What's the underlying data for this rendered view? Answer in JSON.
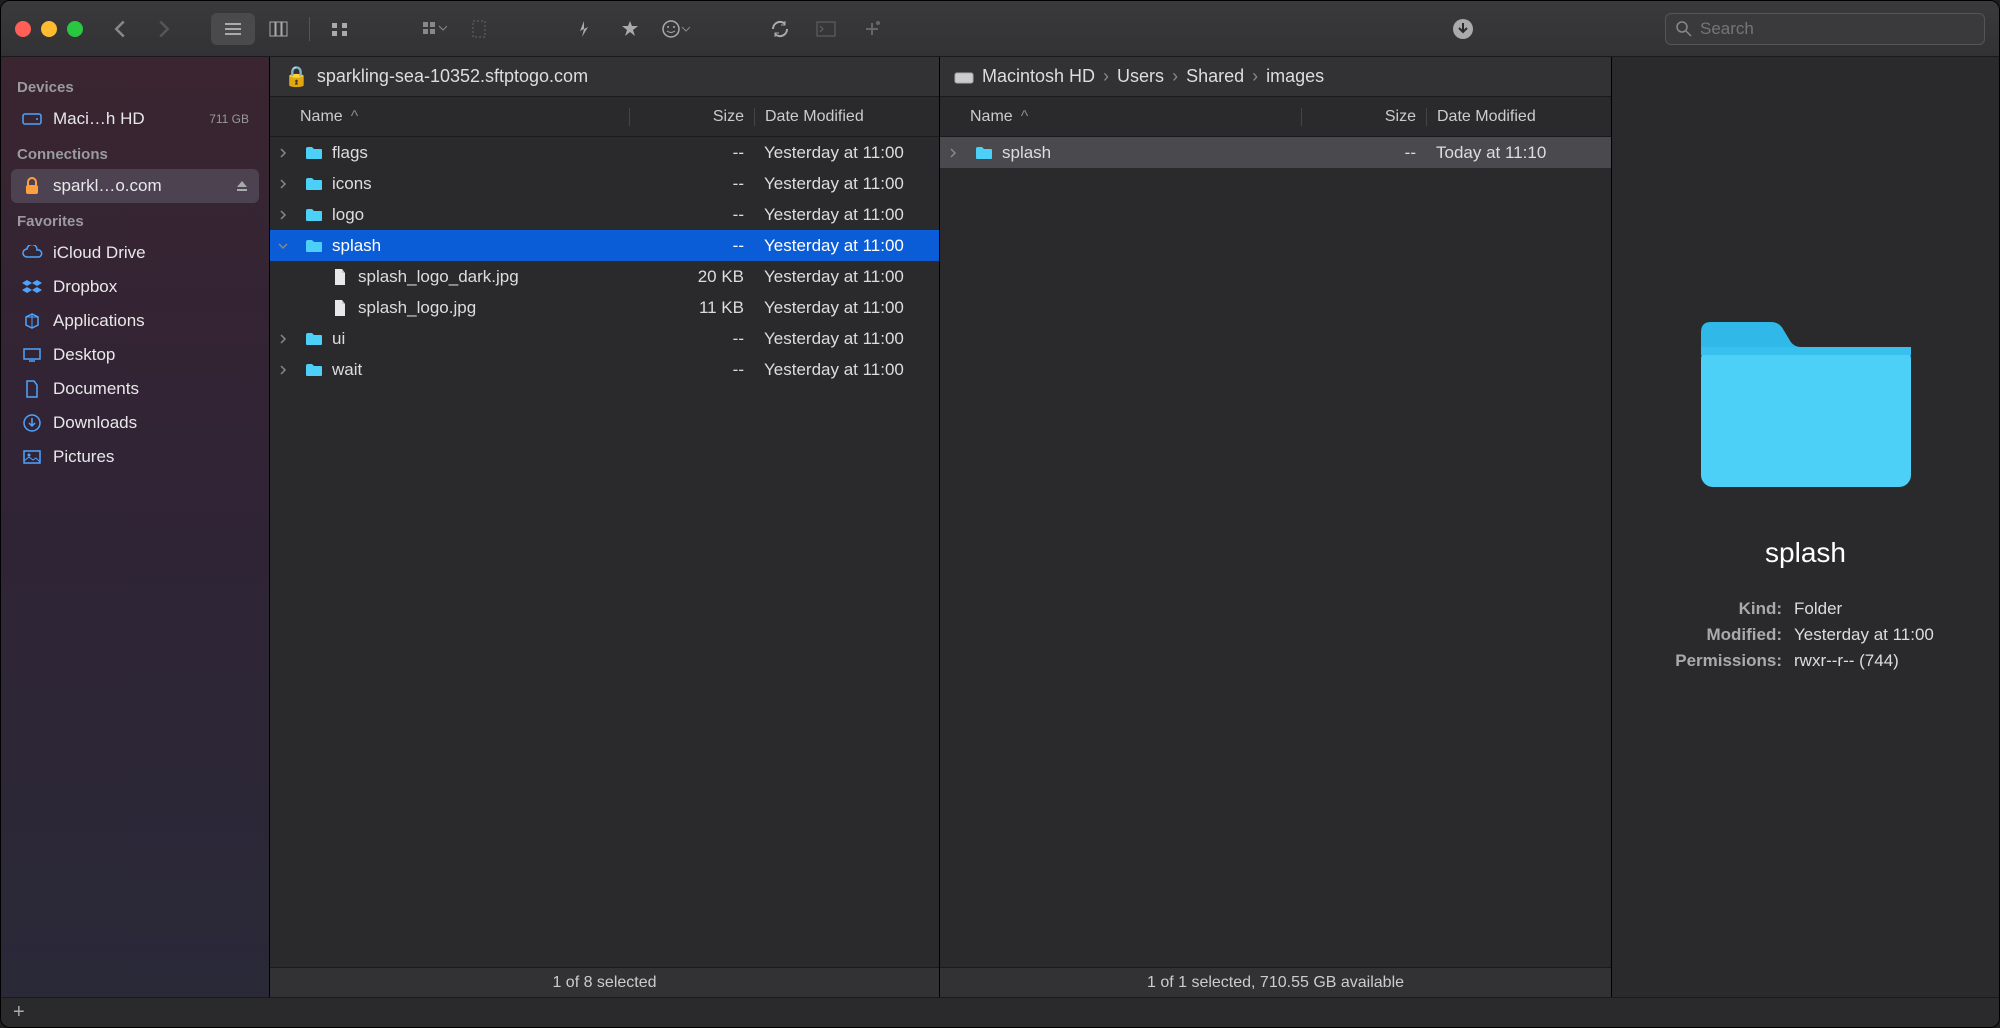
{
  "search": {
    "placeholder": "Search"
  },
  "sidebar": {
    "sections": [
      {
        "header": "Devices",
        "items": [
          {
            "icon": "disk",
            "label": "Maci…h HD",
            "badge": "711 GB"
          }
        ]
      },
      {
        "header": "Connections",
        "items": [
          {
            "icon": "lock",
            "label": "sparkl…o.com",
            "selected": true,
            "eject": true
          }
        ]
      },
      {
        "header": "Favorites",
        "items": [
          {
            "icon": "cloud",
            "label": "iCloud Drive"
          },
          {
            "icon": "dropbox",
            "label": "Dropbox"
          },
          {
            "icon": "app",
            "label": "Applications"
          },
          {
            "icon": "desktop",
            "label": "Desktop"
          },
          {
            "icon": "doc",
            "label": "Documents"
          },
          {
            "icon": "download",
            "label": "Downloads"
          },
          {
            "icon": "picture",
            "label": "Pictures"
          }
        ]
      }
    ]
  },
  "left_pane": {
    "path": "sparkling-sea-10352.sftptogo.com",
    "columns": {
      "name": "Name",
      "size": "Size",
      "date": "Date Modified"
    },
    "rows": [
      {
        "type": "folder",
        "name": "flags",
        "size": "--",
        "date": "Yesterday at 11:00",
        "depth": 0,
        "expandable": true
      },
      {
        "type": "folder",
        "name": "icons",
        "size": "--",
        "date": "Yesterday at 11:00",
        "depth": 0,
        "expandable": true
      },
      {
        "type": "folder",
        "name": "logo",
        "size": "--",
        "date": "Yesterday at 11:00",
        "depth": 0,
        "expandable": true
      },
      {
        "type": "folder",
        "name": "splash",
        "size": "--",
        "date": "Yesterday at 11:00",
        "depth": 0,
        "expandable": true,
        "expanded": true,
        "selected": true
      },
      {
        "type": "file",
        "name": "splash_logo_dark.jpg",
        "size": "20 KB",
        "date": "Yesterday at 11:00",
        "depth": 1
      },
      {
        "type": "file",
        "name": "splash_logo.jpg",
        "size": "11 KB",
        "date": "Yesterday at 11:00",
        "depth": 1
      },
      {
        "type": "folder",
        "name": "ui",
        "size": "--",
        "date": "Yesterday at 11:00",
        "depth": 0,
        "expandable": true
      },
      {
        "type": "folder",
        "name": "wait",
        "size": "--",
        "date": "Yesterday at 11:00",
        "depth": 0,
        "expandable": true
      }
    ],
    "status": "1 of 8 selected"
  },
  "right_pane": {
    "breadcrumbs": [
      "Macintosh HD",
      "Users",
      "Shared",
      "images"
    ],
    "columns": {
      "name": "Name",
      "size": "Size",
      "date": "Date Modified"
    },
    "rows": [
      {
        "type": "folder",
        "name": "splash",
        "size": "--",
        "date": "Today at 11:10",
        "depth": 0,
        "expandable": true,
        "selected_gray": true
      }
    ],
    "status": "1 of 1 selected, 710.55 GB available"
  },
  "info": {
    "title": "splash",
    "meta": [
      {
        "label": "Kind:",
        "value": "Folder"
      },
      {
        "label": "Modified:",
        "value": "Yesterday at 11:00"
      },
      {
        "label": "Permissions:",
        "value": "rwxr--r-- (744)"
      }
    ]
  }
}
